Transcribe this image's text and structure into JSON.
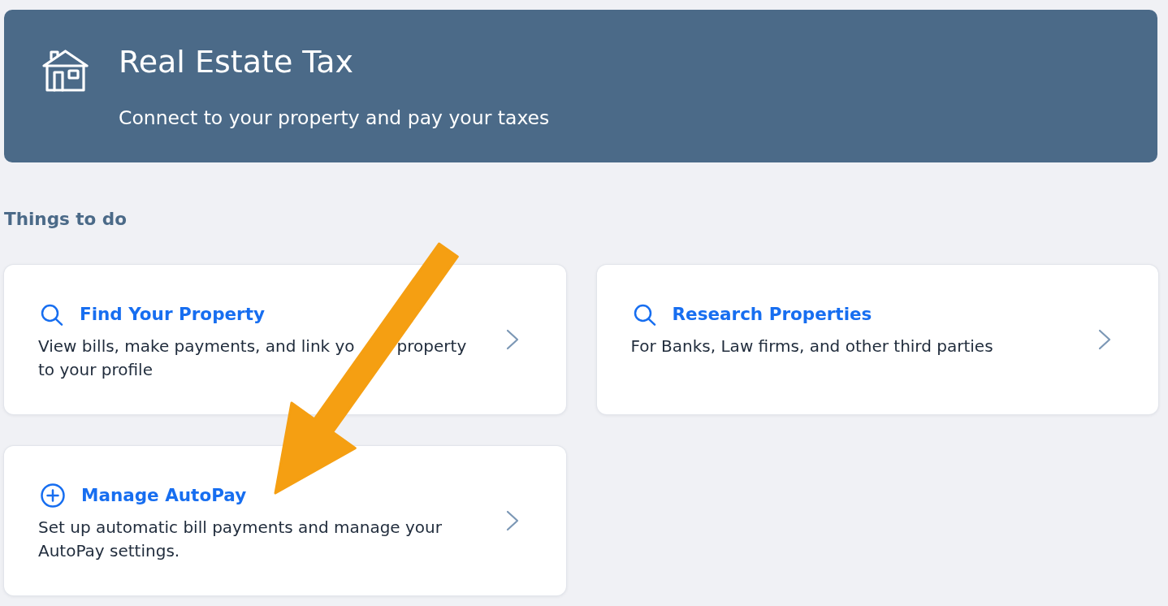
{
  "header": {
    "title": "Real Estate Tax",
    "subtitle": "Connect to your property and pay your taxes"
  },
  "section": {
    "title": "Things to do"
  },
  "tasks": [
    {
      "kind": "search",
      "title": "Find Your Property",
      "description": [
        [
          "View bills, make payments, and link yo",
          "property"
        ],
        [
          "to your profile"
        ]
      ]
    },
    {
      "kind": "search",
      "title": "Research Properties",
      "description": [
        [
          "For Banks, Law firms, and other third parties"
        ]
      ]
    },
    {
      "kind": "add",
      "title": "Manage AutoPay",
      "description": [
        [
          "Set up automatic bill payments and manage your AutoPay settings."
        ]
      ]
    }
  ],
  "annotation": {
    "kind": "arrow"
  }
}
